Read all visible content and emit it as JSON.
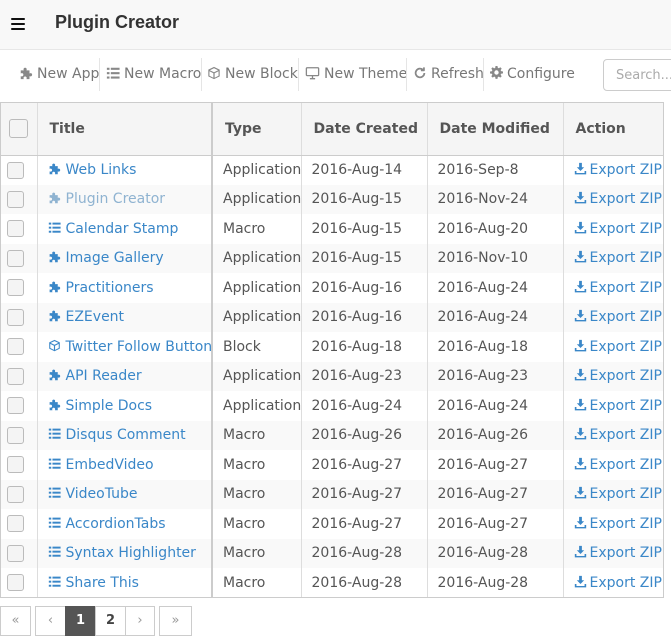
{
  "header": {
    "menu_icon": "hamburger-icon",
    "title": "Plugin Creator"
  },
  "toolbar": {
    "new_app": "New App",
    "new_macro": "New Macro",
    "new_block": "New Block",
    "new_theme": "New Theme",
    "refresh": "Refresh",
    "configure": "Configure",
    "icons": [
      "puzzle-icon",
      "list-icon",
      "cube-icon",
      "monitor-icon",
      "refresh-icon",
      "gear-icon"
    ]
  },
  "search": {
    "placeholder": "Search..."
  },
  "table": {
    "columns": [
      "Title",
      "Type",
      "Date Created",
      "Date Modified",
      "Action"
    ],
    "rows": [
      {
        "icon": "puzzle-icon",
        "title": "Web Links",
        "type": "Application",
        "created": "2016-Aug-14",
        "modified": "2016-Sep-8",
        "action": "Export ZIP",
        "muted": false
      },
      {
        "icon": "puzzle-icon",
        "title": "Plugin Creator",
        "type": "Application",
        "created": "2016-Aug-15",
        "modified": "2016-Nov-24",
        "action": "Export ZIP",
        "muted": true
      },
      {
        "icon": "list-icon",
        "title": "Calendar Stamp",
        "type": "Macro",
        "created": "2016-Aug-15",
        "modified": "2016-Aug-20",
        "action": "Export ZIP",
        "muted": false
      },
      {
        "icon": "puzzle-icon",
        "title": "Image Gallery",
        "type": "Application",
        "created": "2016-Aug-15",
        "modified": "2016-Nov-10",
        "action": "Export ZIP",
        "muted": false
      },
      {
        "icon": "puzzle-icon",
        "title": "Practitioners",
        "type": "Application",
        "created": "2016-Aug-16",
        "modified": "2016-Aug-24",
        "action": "Export ZIP",
        "muted": false
      },
      {
        "icon": "puzzle-icon",
        "title": "EZEvent",
        "type": "Application",
        "created": "2016-Aug-16",
        "modified": "2016-Aug-24",
        "action": "Export ZIP",
        "muted": false
      },
      {
        "icon": "cube-icon",
        "title": "Twitter Follow Button",
        "type": "Block",
        "created": "2016-Aug-18",
        "modified": "2016-Aug-18",
        "action": "Export ZIP",
        "muted": false
      },
      {
        "icon": "puzzle-icon",
        "title": "API Reader",
        "type": "Application",
        "created": "2016-Aug-23",
        "modified": "2016-Aug-23",
        "action": "Export ZIP",
        "muted": false
      },
      {
        "icon": "puzzle-icon",
        "title": "Simple Docs",
        "type": "Application",
        "created": "2016-Aug-24",
        "modified": "2016-Aug-24",
        "action": "Export ZIP",
        "muted": false
      },
      {
        "icon": "list-icon",
        "title": "Disqus Comment",
        "type": "Macro",
        "created": "2016-Aug-26",
        "modified": "2016-Aug-26",
        "action": "Export ZIP",
        "muted": false
      },
      {
        "icon": "list-icon",
        "title": "EmbedVideo",
        "type": "Macro",
        "created": "2016-Aug-27",
        "modified": "2016-Aug-27",
        "action": "Export ZIP",
        "muted": false
      },
      {
        "icon": "list-icon",
        "title": "VideoTube",
        "type": "Macro",
        "created": "2016-Aug-27",
        "modified": "2016-Aug-27",
        "action": "Export ZIP",
        "muted": false
      },
      {
        "icon": "list-icon",
        "title": "AccordionTabs",
        "type": "Macro",
        "created": "2016-Aug-27",
        "modified": "2016-Aug-27",
        "action": "Export ZIP",
        "muted": false
      },
      {
        "icon": "list-icon",
        "title": "Syntax Highlighter",
        "type": "Macro",
        "created": "2016-Aug-28",
        "modified": "2016-Aug-28",
        "action": "Export ZIP",
        "muted": false
      },
      {
        "icon": "list-icon",
        "title": "Share This",
        "type": "Macro",
        "created": "2016-Aug-28",
        "modified": "2016-Aug-28",
        "action": "Export ZIP",
        "muted": false
      }
    ]
  },
  "pagination": {
    "first": "«",
    "prev": "‹",
    "pages": [
      "1",
      "2"
    ],
    "current": "1",
    "next": "›",
    "last": "»"
  },
  "colors": {
    "link": "#3a87c8",
    "link_muted": "#8fb3d1",
    "active_page": "#555555"
  }
}
